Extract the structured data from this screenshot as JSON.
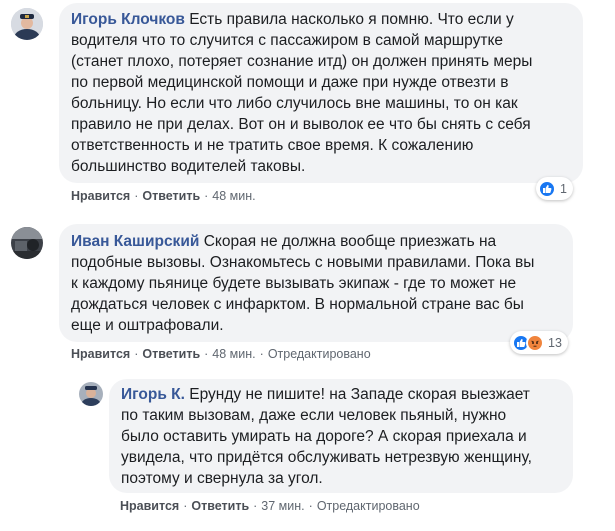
{
  "comments": [
    {
      "author": "Игорь Клочков",
      "lines": [
        "Есть правила насколько я помню. Что если у",
        "водителя что то случится с пассажиром в самой маршрутке",
        "(станет плохо, потеряет сознание итд) он должен принять меры",
        "по первой медицинской помощи и даже при нужде отвезти в",
        "больницу. Но если что либо случилось вне машины, то он как",
        "правило не при делах. Вот он и выволок ее что бы снять с себя",
        "ответственность и не тратить свое время. К сожалению",
        "большинство водителей таковы."
      ],
      "like_label": "Нравится",
      "reply_label": "Ответить",
      "time": "48 мин.",
      "reactions": {
        "icons": [
          "like-icon"
        ],
        "count": "1"
      }
    },
    {
      "author": "Иван Каширский",
      "lines": [
        "Скорая не должна вообще приезжать на",
        "подобные вызовы. Ознакомьтесь с новыми правилами. Пока вы",
        "к каждому пьянице будете вызывать экипаж - где то может не",
        "дождаться человек с инфарктом. В нормальной стране вас бы",
        "еще и оштрафовали."
      ],
      "like_label": "Нравится",
      "reply_label": "Ответить",
      "time": "48 мин.",
      "edited": "Отредактировано",
      "reactions": {
        "icons": [
          "like-icon",
          "angry-icon"
        ],
        "count": "13"
      }
    },
    {
      "author": "Игорь К.",
      "lines": [
        "Ерунду не пишите! на Западе скорая выезжает",
        "по таким вызовам, даже если человек пьяный, нужно",
        "было оставить умирать на дороге? А скорая приехала и",
        "увидела, что придётся обслуживать нетрезвую женщину,",
        "поэтому и свернула за угол."
      ],
      "like_label": "Нравится",
      "reply_label": "Ответить",
      "time": "37 мин.",
      "edited": "Отредактировано"
    }
  ],
  "colors": {
    "author": "#385898",
    "bubble": "#f2f3f5",
    "like": "#1877f2",
    "angry": "#f0843c"
  }
}
